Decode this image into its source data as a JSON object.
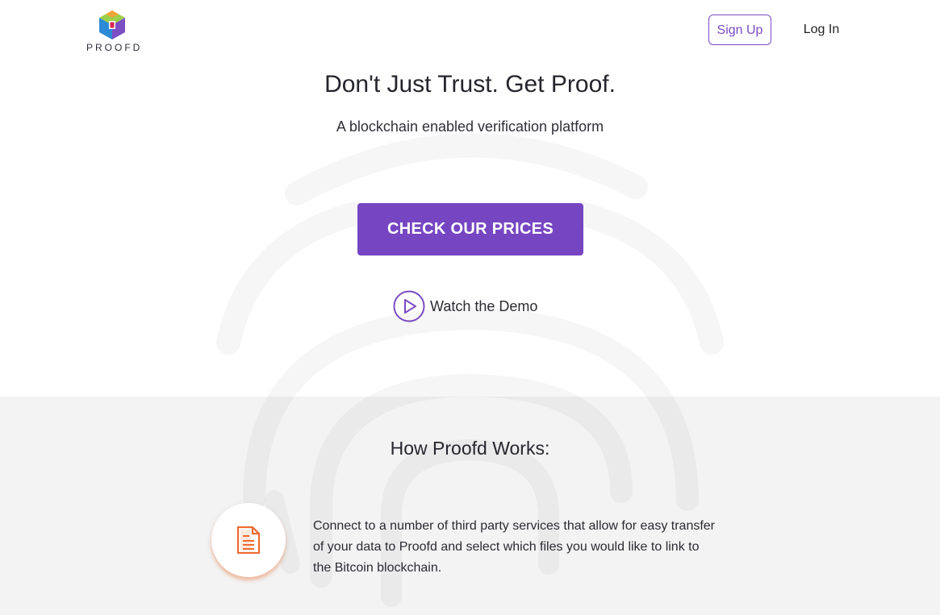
{
  "header": {
    "logo_text": "PROOFD",
    "signup_label": "Sign Up",
    "login_label": "Log In"
  },
  "hero": {
    "title": "Don't Just Trust. Get Proof.",
    "subtitle": "A blockchain enabled verification platform",
    "cta_label": "CHECK OUR PRICES",
    "demo_label": "Watch the Demo"
  },
  "how_it_works": {
    "title": "How Proofd Works:",
    "steps": [
      {
        "icon": "document-icon",
        "text": "Connect to a number of third party services that allow for easy transfer of your data to Proofd and select which files you would like to link to the Bitcoin blockchain."
      }
    ]
  },
  "colors": {
    "accent": "#7646c2",
    "step_icon": "#f06a2f",
    "section_bg": "#f3f3f3"
  }
}
